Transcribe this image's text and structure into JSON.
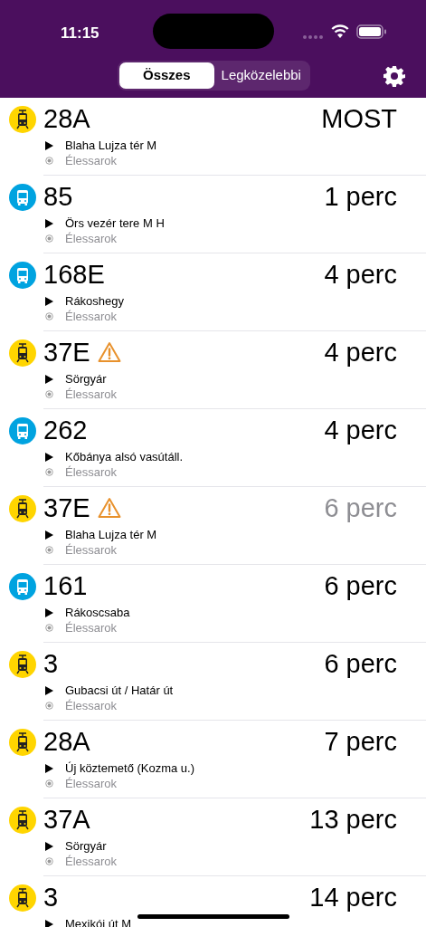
{
  "status_bar": {
    "time": "11:15"
  },
  "tabs": [
    {
      "label": "Összes",
      "selected": true
    },
    {
      "label": "Legközelebbi",
      "selected": false
    }
  ],
  "departures": [
    {
      "kind": "tram",
      "route": "28A",
      "warning": false,
      "time": "MOST",
      "realtime": true,
      "direction": "Blaha Lujza tér M",
      "stop": "Élessarok"
    },
    {
      "kind": "bus",
      "route": "85",
      "warning": false,
      "time": "1 perc",
      "realtime": true,
      "direction": "Örs vezér tere M H",
      "stop": "Élessarok"
    },
    {
      "kind": "bus",
      "route": "168E",
      "warning": false,
      "time": "4 perc",
      "realtime": true,
      "direction": "Rákoshegy",
      "stop": "Élessarok"
    },
    {
      "kind": "tram",
      "route": "37E",
      "warning": true,
      "time": "4 perc",
      "realtime": true,
      "direction": "Sörgyár",
      "stop": "Élessarok"
    },
    {
      "kind": "bus",
      "route": "262",
      "warning": false,
      "time": "4 perc",
      "realtime": true,
      "direction": "Kőbánya alsó vasútáll.",
      "stop": "Élessarok"
    },
    {
      "kind": "tram",
      "route": "37E",
      "warning": true,
      "time": "6 perc",
      "realtime": false,
      "direction": "Blaha Lujza tér M",
      "stop": "Élessarok"
    },
    {
      "kind": "bus",
      "route": "161",
      "warning": false,
      "time": "6 perc",
      "realtime": true,
      "direction": "Rákoscsaba",
      "stop": "Élessarok"
    },
    {
      "kind": "tram",
      "route": "3",
      "warning": false,
      "time": "6 perc",
      "realtime": true,
      "direction": "Gubacsi út / Határ út",
      "stop": "Élessarok"
    },
    {
      "kind": "tram",
      "route": "28A",
      "warning": false,
      "time": "7 perc",
      "realtime": true,
      "direction": "Új köztemető (Kozma u.)",
      "stop": "Élessarok"
    },
    {
      "kind": "tram",
      "route": "37A",
      "warning": false,
      "time": "13 perc",
      "realtime": true,
      "direction": "Sörgyár",
      "stop": "Élessarok"
    },
    {
      "kind": "tram",
      "route": "3",
      "warning": false,
      "time": "14 perc",
      "realtime": true,
      "direction": "Mexikói út M"
    }
  ]
}
